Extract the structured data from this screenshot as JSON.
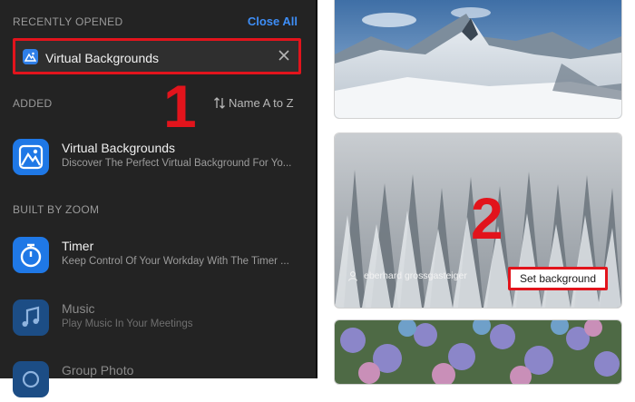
{
  "left_panel": {
    "recently_opened_label": "RECENTLY OPENED",
    "close_all_label": "Close All",
    "search": {
      "value": "Virtual Backgrounds",
      "clear_icon": "close-icon"
    },
    "step1": "1",
    "added_label": "ADDED",
    "sort_label": "Name A to Z",
    "added_apps": [
      {
        "name": "Virtual Backgrounds",
        "description": "Discover The Perfect Virtual Background For Yo...",
        "icon": "mountain-image-icon"
      }
    ],
    "built_by_label": "BUILT BY ZOOM",
    "built_apps": [
      {
        "name": "Timer",
        "description": "Keep Control Of Your Workday With The Timer ...",
        "icon": "stopwatch-icon"
      },
      {
        "name": "Music",
        "description": "Play Music In Your Meetings",
        "icon": "music-note-icon"
      },
      {
        "name": "Group Photo",
        "description": "",
        "icon": "camera-icon"
      }
    ]
  },
  "right_panel": {
    "step2": "2",
    "selected_card": {
      "credit": "eberhard grossgasteiger",
      "set_background_label": "Set background"
    }
  },
  "colors": {
    "accent_blue": "#3e8ef7",
    "highlight_red": "#e2141c",
    "panel_dark": "#232323"
  }
}
